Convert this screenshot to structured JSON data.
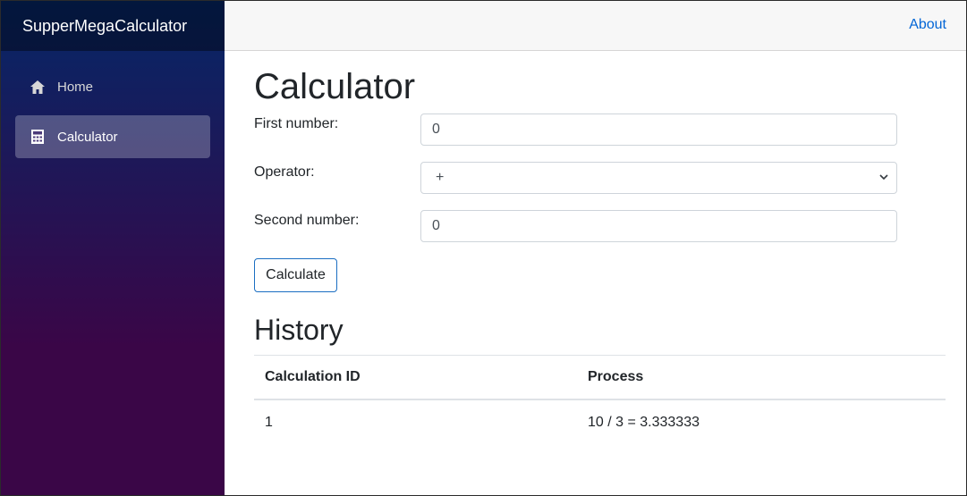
{
  "app": {
    "brand": "SupperMegaCalculator"
  },
  "sidebar": {
    "items": [
      {
        "label": "Home",
        "icon": "home-icon",
        "active": false
      },
      {
        "label": "Calculator",
        "icon": "calculator-icon",
        "active": true
      }
    ]
  },
  "topbar": {
    "about_label": "About"
  },
  "main": {
    "title": "Calculator",
    "form": {
      "first_label": "First number:",
      "first_value": "0",
      "operator_label": "Operator:",
      "operator_value": "+",
      "second_label": "Second number:",
      "second_value": "0",
      "calculate_label": "Calculate"
    },
    "history": {
      "title": "History",
      "columns": [
        "Calculation ID",
        "Process"
      ],
      "rows": [
        [
          "1",
          "10 / 3 = 3.333333"
        ]
      ]
    }
  },
  "colors": {
    "accent": "#1b6ec2",
    "link": "#0366d6",
    "sidebar_top": "#052767",
    "sidebar_bottom": "#3a0647"
  }
}
